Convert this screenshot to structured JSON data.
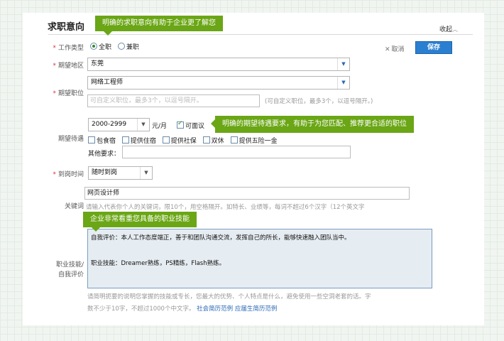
{
  "section": {
    "title": "求职意向",
    "collapse_label": "收起"
  },
  "actions": {
    "cancel_label": "取消",
    "save_label": "保存"
  },
  "job_type": {
    "label": "工作类型",
    "options": [
      {
        "label": "全职",
        "selected": true
      },
      {
        "label": "兼职",
        "selected": false
      }
    ]
  },
  "location": {
    "label": "期望地区",
    "value": "东莞"
  },
  "position": {
    "label": "期望职位",
    "value": "网络工程师",
    "placeholder": "可自定义职位，最多3个，以逗号隔开。",
    "hint": "(可自定义职位，最多3个，以逗号隔开。)"
  },
  "salary": {
    "label": "期望待遇",
    "range": "2000-2999",
    "unit": "元/月",
    "negotiable_label": "可面议",
    "negotiable_checked": true,
    "benefits": [
      "包食宿",
      "提供住宿",
      "提供社保",
      "双休",
      "提供五险一金"
    ],
    "other_label": "其他要求："
  },
  "arrival": {
    "label": "到岗时间",
    "value": "随时到岗"
  },
  "keywords": {
    "label": "关键词",
    "value": "网页设计师",
    "hint": "请输入代表你个人的关键词，限10个，用空格隔开。如特长、业绩等，每词不超过6个汉字（12个英文字"
  },
  "skills": {
    "label_line1": "职业技能/",
    "label_line2": "自我评价",
    "line1": "自我评价：本人工作态度端正，善于和团队沟通交流，发挥自己的所长，能够快速融入团队当中。",
    "line2": "职业技能：Dreamer熟练，PS精练，Flash熟练。",
    "hint_line1": "请简明扼要的说明您掌握的技能或专长，您最大的优势、个人特点是什么，避免使用一些空洞老套的话。字",
    "hint_line2": "数不少于10字，不超过1000个中文字。",
    "link1": "社会简历范例",
    "link2": "应届生简历范例"
  },
  "tips": {
    "tip1": "明确的求职意向有助于企业更了解您",
    "tip2": "明确的期望待遇要求，有助于为您匹配、推荐更合适的职位",
    "tip3": "企业非常看重您具备的职业技能"
  },
  "colors": {
    "tip_green": "#6aa615",
    "save_blue": "#2b7fd0",
    "required_red": "#dd3333"
  }
}
